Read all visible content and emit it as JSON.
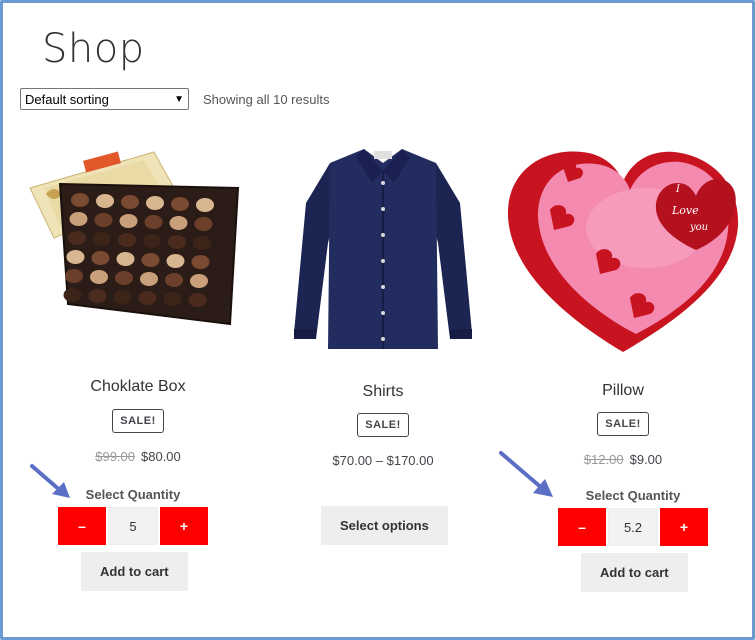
{
  "page": {
    "title": "Shop"
  },
  "toolbar": {
    "sorting_value": "Default sorting",
    "results_text": "Showing all 10 results"
  },
  "products": [
    {
      "title": "Choklate Box",
      "badge": "SALE!",
      "old_price": "$99.00",
      "price": "$80.00",
      "qty_label": "Select Quantity",
      "minus": "–",
      "plus": "+",
      "qty": "5",
      "button": "Add to cart"
    },
    {
      "title": "Shirts",
      "badge": "SALE!",
      "price_range": "$70.00 – $170.00",
      "button": "Select options"
    },
    {
      "title": "Pillow",
      "badge": "SALE!",
      "old_price": "$12.00",
      "price": "$9.00",
      "qty_label": "Select Quantity",
      "minus": "–",
      "plus": "+",
      "qty": "5.2",
      "button": "Add to cart"
    }
  ],
  "colors": {
    "qty_button": "#ff0000",
    "frame": "#6b9bd1",
    "annotation_arrow": "#5b6fc4"
  },
  "icons": [
    "chevron-down-icon",
    "annotation-arrow-icon"
  ]
}
